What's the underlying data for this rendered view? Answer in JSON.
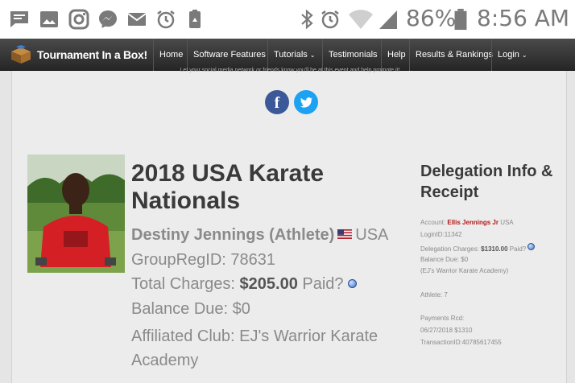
{
  "status_bar": {
    "battery_percent": "86%",
    "time": "8:56 AM",
    "left_icons": [
      "message-icon",
      "image-icon",
      "instagram-icon",
      "messenger-icon",
      "email-icon",
      "alarm-icon",
      "recycle-icon"
    ],
    "right_icons": [
      "bluetooth-icon",
      "alarm-icon",
      "wifi-icon",
      "signal-icon",
      "battery-icon"
    ]
  },
  "navbar": {
    "brand": "Tournament In a Box!",
    "items": [
      {
        "label": "Home"
      },
      {
        "label": "Software Features"
      },
      {
        "label": "Tutorials"
      },
      {
        "label": "Testimonials"
      },
      {
        "label": "Help"
      },
      {
        "label": "Results & Rankings"
      },
      {
        "label": "Login"
      }
    ]
  },
  "share": {
    "text": "Let your social media network or friends know you'll be at this event and help promote it!",
    "facebook_letter": "f"
  },
  "registration": {
    "event_title": "2018 USA Karate Nationals",
    "athlete_name": "Destiny Jennings (Athlete)",
    "country": "USA",
    "group_reg_label": "GroupRegID: 78631",
    "total_charges_label": "Total Charges:",
    "total_charges_value": "$205.00",
    "paid_label": "Paid?",
    "balance_due": "Balance Due: $0",
    "affiliated_club": "Affiliated Club: EJ's Warrior Karate Academy"
  },
  "delegation": {
    "title": "Delegation Info & Receipt",
    "account_label": "Account:",
    "account_name": "Ellis Jennings Jr",
    "account_country": "USA",
    "login_id": "LoginID:11342",
    "charges_label": "Delegation Charges:",
    "charges_value": "$1310.00",
    "paid_label": "Paid?",
    "balance_due": "Balance Due: $0",
    "club": "(EJ's Warrior Karate Academy)",
    "athlete_count": "Athlete: 7",
    "payments_label": "Payments Rcd:",
    "payment_entry": "06/27/2018 $1310",
    "transaction_id": "TransactionID:40785617455"
  },
  "colors": {
    "navbar": "#2f2f2f",
    "facebook": "#3b5998",
    "twitter": "#1da1f2",
    "account_name": "#b01818"
  }
}
